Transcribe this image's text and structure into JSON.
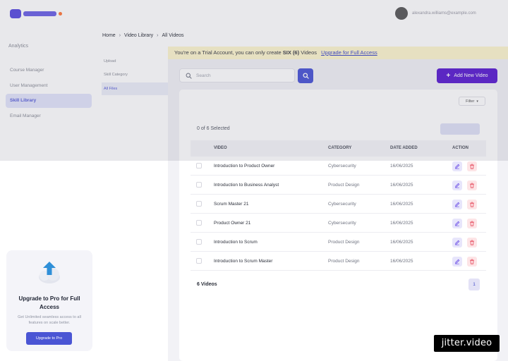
{
  "header": {
    "user_email": "alexandra.williams@example.com"
  },
  "sidebar": {
    "heading": "Analytics",
    "items": [
      {
        "label": "Course Manager"
      },
      {
        "label": "User Management"
      },
      {
        "label": "Skill Library"
      },
      {
        "label": "Email Manager"
      }
    ],
    "upgrade": {
      "title": "Upgrade to Pro for Full Access",
      "description": "Get Unlimited seamless access to all features on scale better.",
      "button": "Upgrade to Pro"
    }
  },
  "subnav": {
    "items": [
      {
        "label": "Upload"
      },
      {
        "label": "Skill Category"
      },
      {
        "label": "All Files"
      }
    ]
  },
  "breadcrumb": {
    "items": [
      "Home",
      "Video Library",
      "All Videos"
    ]
  },
  "trial": {
    "prefix": "You're on a Trial Account, you can only create",
    "highlight": "SIX (6)",
    "suffix": "Videos",
    "link": "Upgrade for Full Access"
  },
  "toolbar": {
    "search_placeholder": "Search",
    "add_label": "Add New Video"
  },
  "table": {
    "filter_label": "Filter",
    "selected_text": "0 of 6 Selected",
    "columns": [
      "VIDEO",
      "CATEGORY",
      "DATE ADDED",
      "ACTION"
    ],
    "rows": [
      {
        "video": "Introduction to Product Owner",
        "category": "Cybersecurity",
        "date": "16/06/2025"
      },
      {
        "video": "Introduction to Business Analyst",
        "category": "Product Design",
        "date": "16/06/2025"
      },
      {
        "video": "Scrum Master 21",
        "category": "Cybersecurity",
        "date": "16/06/2025"
      },
      {
        "video": "Product Owner 21",
        "category": "Cybersecurity",
        "date": "16/06/2025"
      },
      {
        "video": "Introduction to Scrum",
        "category": "Product Design",
        "date": "16/06/2025"
      },
      {
        "video": "Introduction to Scrum Master",
        "category": "Product Design",
        "date": "16/06/2025"
      }
    ],
    "total_label": "6 Videos",
    "page": "1"
  },
  "colors": {
    "primary": "#4b55d6",
    "add_button": "#5b1fd1",
    "trial_banner": "#fdf6cf",
    "edit_icon": "#6b4ee6",
    "delete_icon": "#e5485b"
  },
  "watermark": "jitter.video"
}
